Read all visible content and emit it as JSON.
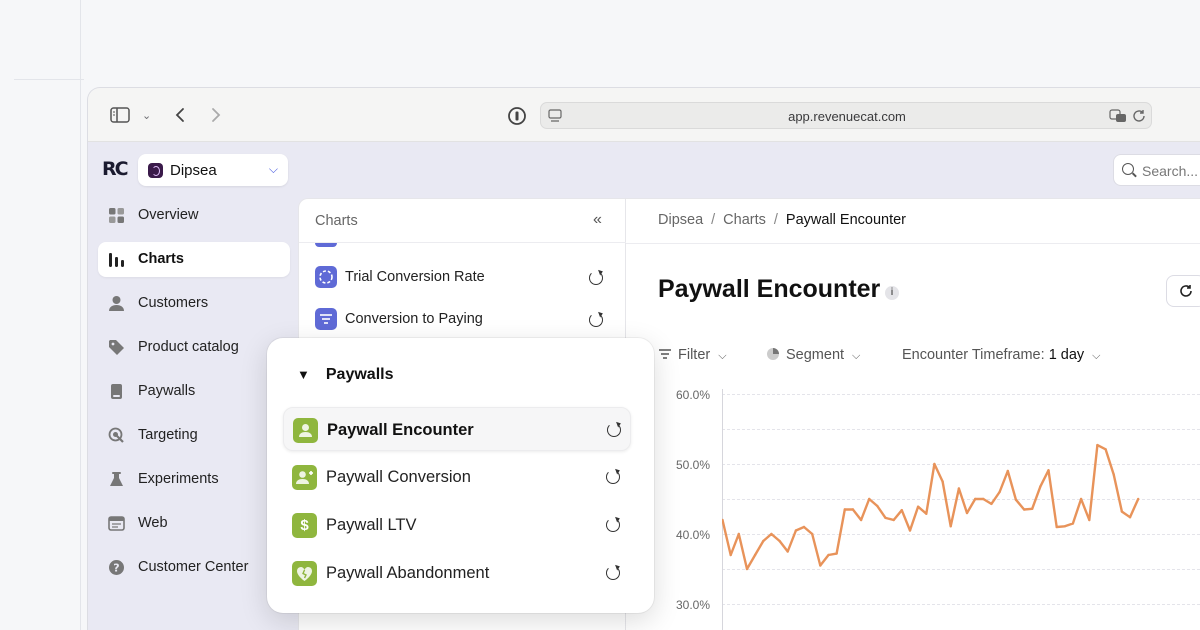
{
  "browser": {
    "url": "app.revenuecat.com"
  },
  "app": {
    "logo_text": "RC",
    "project_name": "Dipsea",
    "search_placeholder": "Search..."
  },
  "sidebar": {
    "items": [
      {
        "label": "Overview",
        "icon": "grid-icon",
        "active": false
      },
      {
        "label": "Charts",
        "icon": "bar-chart-icon",
        "active": true
      },
      {
        "label": "Customers",
        "icon": "user-icon",
        "active": false
      },
      {
        "label": "Product catalog",
        "icon": "tag-icon",
        "active": false
      },
      {
        "label": "Paywalls",
        "icon": "paywall-icon",
        "active": false
      },
      {
        "label": "Targeting",
        "icon": "target-icon",
        "active": false
      },
      {
        "label": "Experiments",
        "icon": "flask-icon",
        "active": false
      },
      {
        "label": "Web",
        "icon": "browser-icon",
        "active": false
      },
      {
        "label": "Customer Center",
        "icon": "help-icon",
        "active": false
      }
    ]
  },
  "charts_panel": {
    "title": "Charts",
    "items": [
      {
        "label": "Trial Conversion Rate",
        "icon": "trial-icon"
      },
      {
        "label": "Conversion to Paying",
        "icon": "funnel-icon"
      }
    ]
  },
  "breadcrumb": {
    "root": "Dipsea",
    "section": "Charts",
    "current": "Paywall Encounter"
  },
  "main": {
    "title": "Paywall Encounter",
    "filter_label": "Filter",
    "segment_label": "Segment",
    "timeframe_label": "Encounter Timeframe:",
    "timeframe_value": "1 day"
  },
  "popover": {
    "group_title": "Paywalls",
    "items": [
      {
        "label": "Paywall Encounter",
        "icon": "person-icon",
        "selected": true
      },
      {
        "label": "Paywall Conversion",
        "icon": "person-plus-icon",
        "selected": false
      },
      {
        "label": "Paywall LTV",
        "icon": "dollar-icon",
        "selected": false
      },
      {
        "label": "Paywall Abandonment",
        "icon": "broken-heart-icon",
        "selected": false
      }
    ]
  },
  "colors": {
    "accent": "#5f6ad6",
    "paywall_green": "#8fb63e",
    "line": "#e8935a"
  },
  "chart_data": {
    "type": "line",
    "y_ticks": [
      "60.0%",
      "50.0%",
      "40.0%",
      "30.0%"
    ],
    "ylim": [
      30,
      60
    ],
    "series": [
      {
        "values": [
          42.0,
          37.0,
          40.0,
          35.0,
          37.0,
          39.0,
          40.0,
          39.0,
          37.5,
          40.5,
          41.0,
          40.0,
          35.5,
          37.0,
          37.2,
          43.5,
          43.5,
          42.0,
          45.0,
          44.0,
          42.3,
          42.0,
          43.4,
          40.5,
          43.9,
          42.9,
          50.0,
          47.5,
          41.1,
          46.5,
          43.0,
          45.0,
          45.0,
          44.3,
          46.0,
          49.0,
          44.9,
          43.5,
          43.6,
          46.8,
          49.1,
          41.0,
          41.1,
          41.5,
          45.0,
          42.0,
          52.7,
          52.1,
          48.5,
          43.2,
          42.4,
          45.0
        ]
      }
    ],
    "grid": true
  }
}
